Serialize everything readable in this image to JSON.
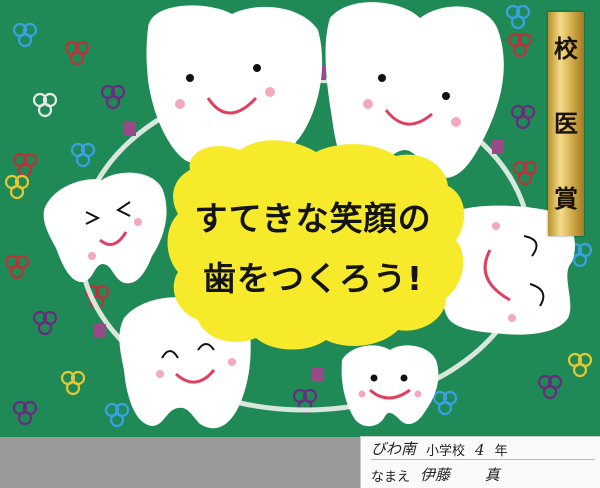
{
  "award": {
    "chars": [
      "校",
      "医",
      "賞"
    ]
  },
  "slogan": {
    "line1": "すてきな笑顔の",
    "line2": "歯をつくろう!"
  },
  "label": {
    "school_name": "びわ南",
    "school_suffix": "小学校",
    "grade_number": "4",
    "grade_suffix": "年",
    "name_prefix": "なまえ",
    "student_name": "伊藤 　　真"
  },
  "colors": {
    "board": "#1f8a55",
    "slogan_bg": "#f7ea2a",
    "tooth": "#ffffff",
    "smile": "#e04060",
    "braces": "#9a4a88",
    "ribbon": "#d8b650"
  }
}
